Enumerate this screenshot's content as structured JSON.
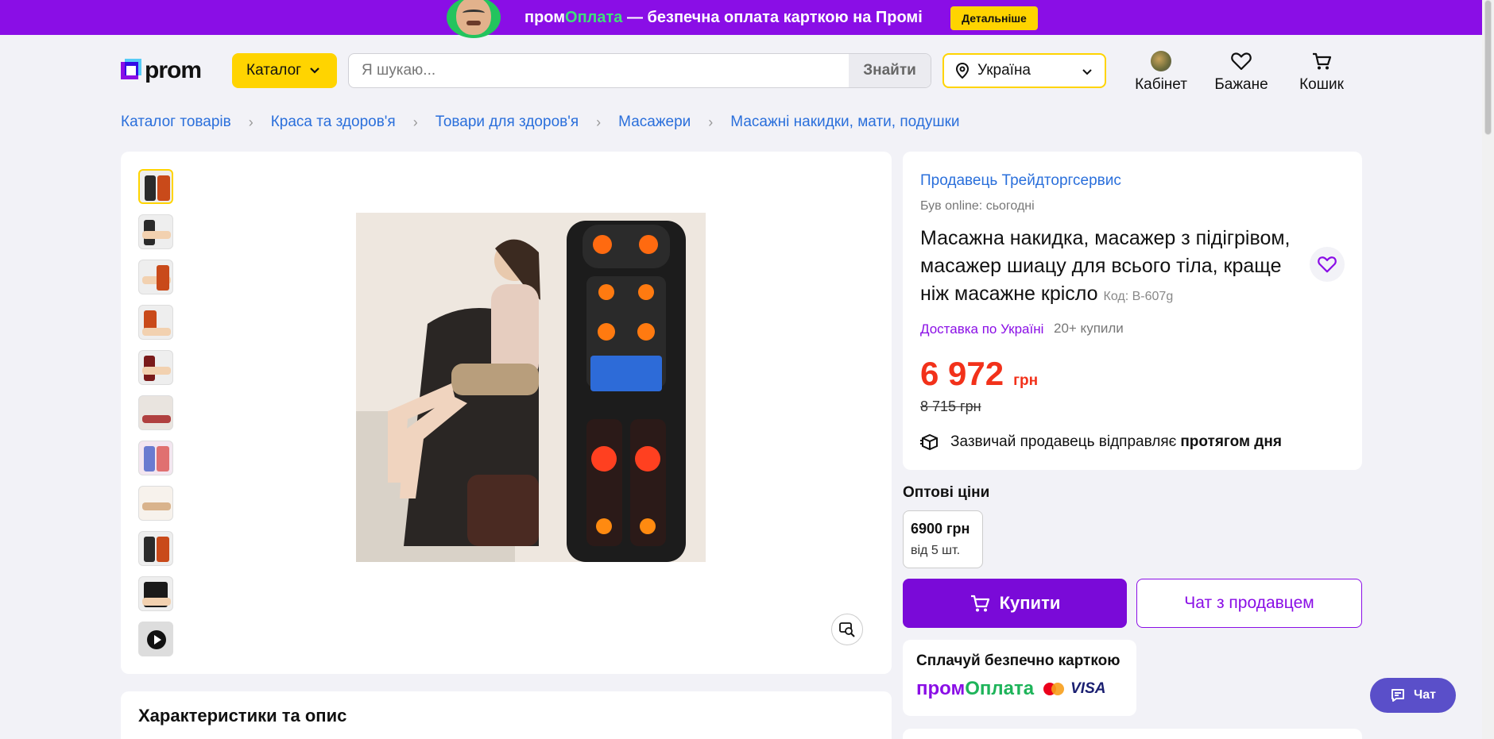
{
  "promo": {
    "brand_part1": "пром",
    "brand_part2": "Оплата",
    "text": " — безпечна оплата карткою на Промі",
    "button_label": "Детальніше"
  },
  "header": {
    "logo": "prom",
    "catalog_label": "Каталог",
    "search_placeholder": "Я шукаю...",
    "search_value": "",
    "search_button": "Знайти",
    "region": "Україна",
    "cabinet_label": "Кабінет",
    "wishlist_label": "Бажане",
    "cart_label": "Кошик"
  },
  "breadcrumb": [
    "Каталог товарів",
    "Краса та здоров'я",
    "Товари для здоров'я",
    "Масажери",
    "Масажні накидки, мати, подушки"
  ],
  "gallery": {
    "thumbnail_count": 11,
    "active_index": 0,
    "last_is_video": true
  },
  "product": {
    "seller": "Продавець Трейдторгсервис",
    "online_status": "Був online: сьогодні",
    "title": "Масажна накидка, масажер з підігрівом, масажер шиацу для всього тіла, краще ніж масажне крісло",
    "code": "Код: B-607g",
    "delivery": "Доставка по Україні",
    "bought": "20+ купили",
    "price": "6 972",
    "currency": "грн",
    "old_price": "8 715 грн",
    "ship_text": "Зазвичай продавець відправляє",
    "ship_bold": "протягом дня"
  },
  "wholesale": {
    "label": "Оптові ціни",
    "price": "6900 грн",
    "qty": "від 5 шт."
  },
  "actions": {
    "buy_label": "Купити",
    "chat_seller_label": "Чат з продавцем"
  },
  "payment": {
    "title": "Сплачуй безпечно карткою",
    "brand_part1": "пром",
    "brand_part2": "Оплата",
    "visa": "VISA"
  },
  "description": {
    "title": "Характеристики та опис"
  },
  "chat_widget": {
    "label": "Чат"
  },
  "colors": {
    "brand_purple": "#8a0ee6",
    "accent_yellow": "#ffd400",
    "price_red": "#f2311a",
    "link_blue": "#2a6fdb"
  }
}
